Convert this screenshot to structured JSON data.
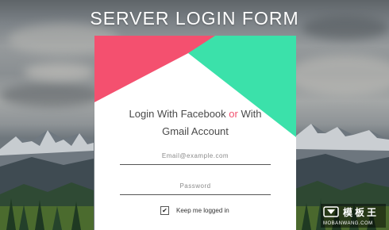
{
  "page": {
    "title": "SERVER LOGIN FORM"
  },
  "form": {
    "heading_line1_a": "Login With Facebook ",
    "heading_line1_or": "or",
    "heading_line1_b": " With",
    "heading_line2": "Gmail Account",
    "email_placeholder": "Email@example.com",
    "password_placeholder": "Password",
    "remember_label": "Keep me logged in",
    "remember_checked": true,
    "check_mark": "✔"
  },
  "watermark": {
    "title": "模板王",
    "subtitle": "MOBANWANG.COM"
  },
  "colors": {
    "facebook_shape": "#f4506f",
    "gmail_shape": "#3be1aa",
    "accent_or": "#f2506e"
  }
}
